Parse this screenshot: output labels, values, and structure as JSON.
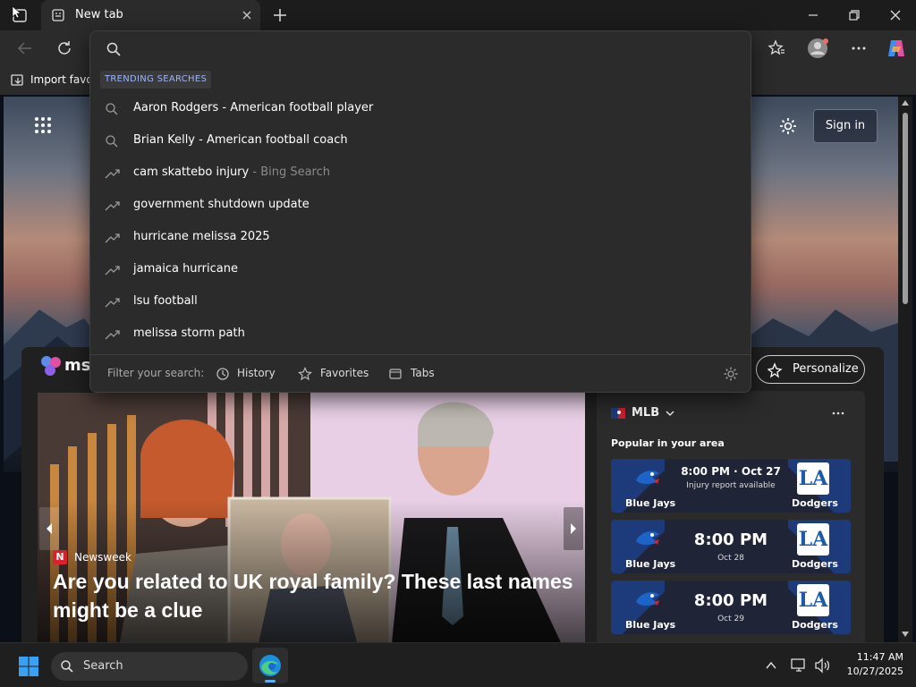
{
  "browser": {
    "tab_title": "New tab",
    "bookmark_label": "Import favor"
  },
  "dropdown": {
    "section_label": "TRENDING SEARCHES",
    "suggestions": [
      {
        "text": "Aaron Rodgers",
        "detail": " - American football player",
        "icon": "search-icon"
      },
      {
        "text": "Brian Kelly",
        "detail": " - American football coach",
        "icon": "search-icon"
      },
      {
        "text": "cam skattebo injury",
        "detail": " - Bing Search",
        "icon": "trending-icon"
      },
      {
        "text": "government shutdown update",
        "detail": "",
        "icon": "trending-icon"
      },
      {
        "text": "hurricane melissa 2025",
        "detail": "",
        "icon": "trending-icon"
      },
      {
        "text": "jamaica hurricane",
        "detail": "",
        "icon": "trending-icon"
      },
      {
        "text": "lsu football",
        "detail": "",
        "icon": "trending-icon"
      },
      {
        "text": "melissa storm path",
        "detail": "",
        "icon": "trending-icon"
      }
    ],
    "filter": {
      "label": "Filter your search:",
      "history": "History",
      "favorites": "Favorites",
      "tabs": "Tabs"
    }
  },
  "msn": {
    "logo_text": "msn",
    "sign_in": "Sign in",
    "personalize": "Personalize"
  },
  "news": {
    "source": "Newsweek",
    "source_badge": "N",
    "headline": "Are you related to UK royal family? These last names might be a clue"
  },
  "mlb": {
    "title": "MLB",
    "subtitle": "Popular in your area",
    "games": [
      {
        "home": "Blue Jays",
        "away": "Dodgers",
        "time": "8:00 PM · Oct 27",
        "note": "Injury report available",
        "logo_text": "LA"
      },
      {
        "home": "Blue Jays",
        "away": "Dodgers",
        "time": "8:00 PM",
        "note": "Oct 28",
        "logo_text": "LA"
      },
      {
        "home": "Blue Jays",
        "away": "Dodgers",
        "time": "8:00 PM",
        "note": "Oct 29",
        "logo_text": "LA"
      }
    ]
  },
  "taskbar": {
    "search": "Search",
    "time": "11:47 AM",
    "date": "10/27/2025"
  },
  "colors": {
    "accent": "#9bb5ff",
    "panel": "#2b2b2b",
    "newsweek_red": "#d6232d",
    "game_card": "#1f2437"
  }
}
